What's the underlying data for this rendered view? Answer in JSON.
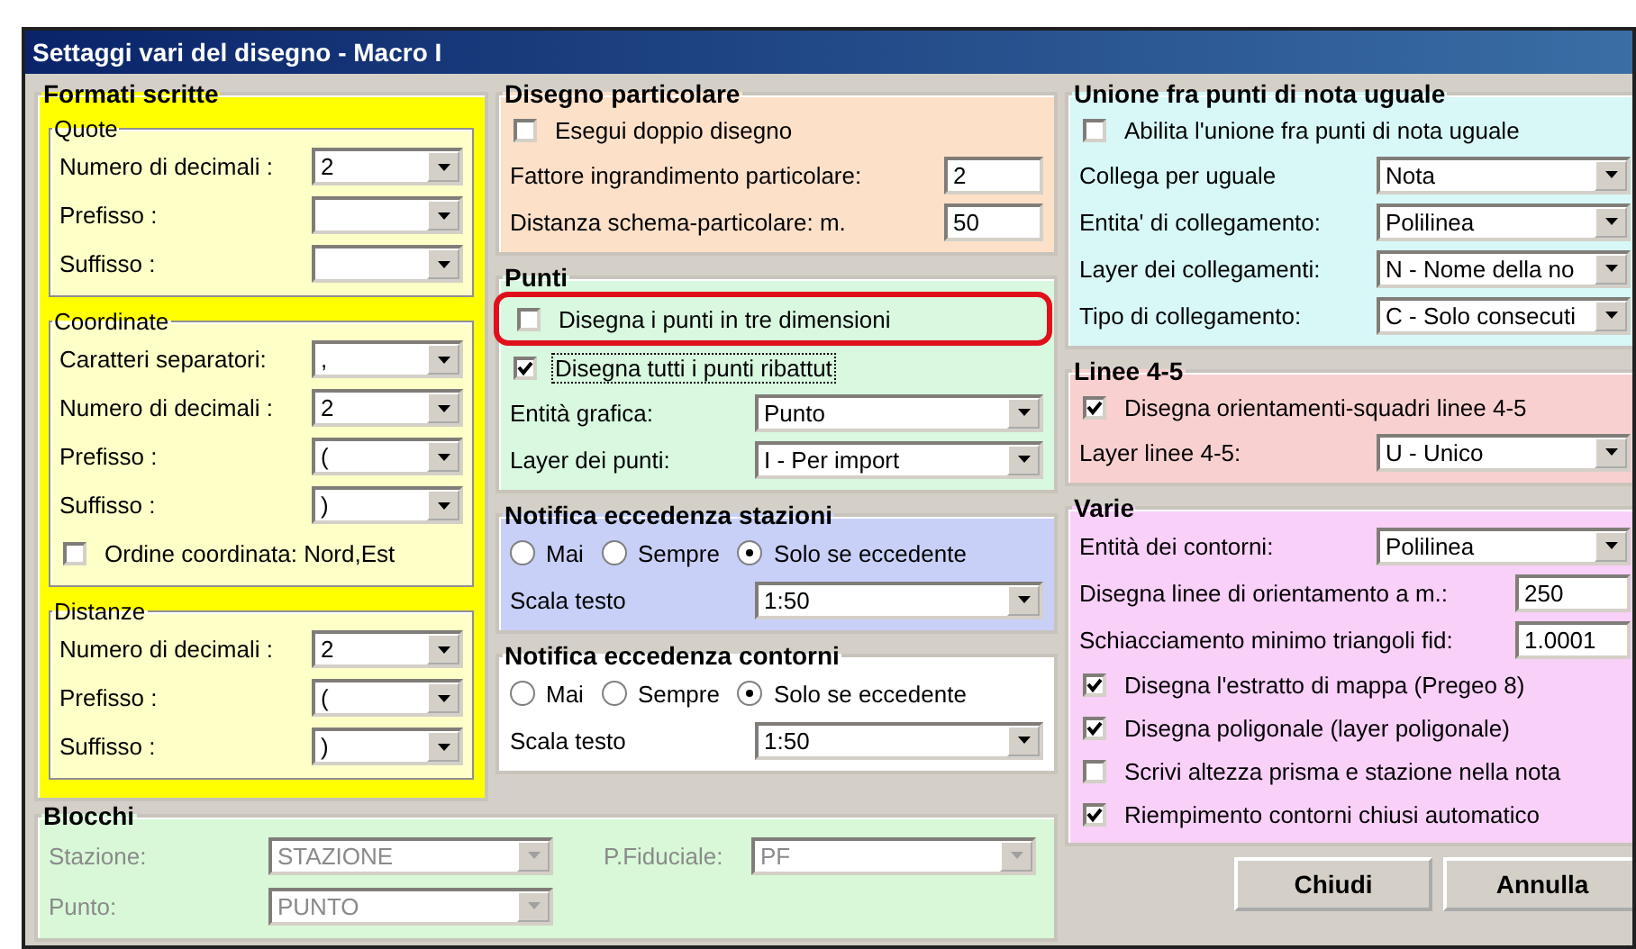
{
  "window": {
    "title": "Settaggi vari del disegno - Macro I"
  },
  "columns": [
    {
      "groups": [
        {
          "title": "Formati scritte",
          "color": "#ffff00",
          "items": [
            {
              "kind": "group",
              "title": "Quote",
              "color": "#ffffc8",
              "items": [
                {
                  "kind": "combo",
                  "label": "Numero di decimali :",
                  "value": "2"
                },
                {
                  "kind": "combo",
                  "label": "Prefisso :"
                },
                {
                  "kind": "combo",
                  "label": "Suffisso :"
                }
              ]
            },
            {
              "kind": "group",
              "title": "Coordinate",
              "color": "#ffffc8",
              "items": [
                {
                  "kind": "combo",
                  "label": "Caratteri separatori:",
                  "value": ","
                },
                {
                  "kind": "combo",
                  "label": "Numero di decimali :",
                  "value": "2"
                },
                {
                  "kind": "combo",
                  "label": "Prefisso :",
                  "value": "("
                },
                {
                  "kind": "combo",
                  "label": "Suffisso :",
                  "value": ")"
                },
                {
                  "kind": "check",
                  "label": "Ordine coordinata: Nord,Est",
                  "checked": false
                }
              ]
            },
            {
              "kind": "group",
              "title": "Distanze",
              "color": "#ffffc8",
              "items": [
                {
                  "kind": "combo",
                  "label": "Numero di decimali :",
                  "value": "2"
                },
                {
                  "kind": "combo",
                  "label": "Prefisso :",
                  "value": "("
                },
                {
                  "kind": "combo",
                  "label": "Suffisso :",
                  "value": ")"
                }
              ]
            }
          ]
        }
      ]
    },
    {
      "groups": [
        {
          "title": "Disegno particolare",
          "color": "#fce0c8",
          "items": [
            {
              "kind": "check",
              "label": "Esegui doppio disegno",
              "checked": false
            },
            {
              "kind": "input",
              "label": "Fattore ingrandimento particolare:",
              "value": "2"
            },
            {
              "kind": "input",
              "label": "Distanza schema-particolare: m.",
              "value": "50"
            }
          ]
        },
        {
          "title": "Punti",
          "color": "#d8f8e0",
          "items": [
            {
              "kind": "check",
              "label": "Disegna i punti in tre dimensioni",
              "checked": false,
              "highlighted": true
            },
            {
              "kind": "check",
              "label": "Disegna tutti i punti ribattut",
              "checked": true,
              "focused": true
            },
            {
              "kind": "combo",
              "label": "Entità grafica:",
              "value": "Punto"
            },
            {
              "kind": "combo",
              "label": "Layer dei punti:",
              "value": "I - Per import"
            }
          ]
        },
        {
          "title": "Notifica eccedenza stazioni",
          "color": "#c8d0f8",
          "items": [
            {
              "kind": "radios",
              "options": [
                {
                  "label": "Mai",
                  "selected": false
                },
                {
                  "label": "Sempre",
                  "selected": false
                },
                {
                  "label": "Solo se eccedente",
                  "selected": true
                }
              ]
            },
            {
              "kind": "combo",
              "label": "Scala testo",
              "value": "1:50"
            }
          ]
        },
        {
          "title": "Notifica eccedenza contorni",
          "color": "#ffffff",
          "items": [
            {
              "kind": "radios",
              "options": [
                {
                  "label": "Mai",
                  "selected": false
                },
                {
                  "label": "Sempre",
                  "selected": false
                },
                {
                  "label": "Solo se eccedente",
                  "selected": true
                }
              ]
            },
            {
              "kind": "combo",
              "label": "Scala testo",
              "value": "1:50"
            }
          ]
        }
      ]
    },
    {
      "groups": [
        {
          "title": "Unione fra punti di nota uguale",
          "color": "#d8f8f8",
          "items": [
            {
              "kind": "check",
              "label": "Abilita l'unione fra punti di nota uguale",
              "checked": false
            },
            {
              "kind": "combo",
              "label": "Collega per uguale",
              "value": "Nota"
            },
            {
              "kind": "combo",
              "label": "Entita' di collegamento:",
              "value": "Polilinea"
            },
            {
              "kind": "combo",
              "label": "Layer dei collegamenti:",
              "value": "N - Nome della no"
            },
            {
              "kind": "combo",
              "label": "Tipo di collegamento:",
              "value": "C - Solo consecuti"
            }
          ]
        },
        {
          "title": "Linee 4-5",
          "color": "#f8d0d0",
          "items": [
            {
              "kind": "check",
              "label": "Disegna orientamenti-squadri linee 4-5",
              "checked": true
            },
            {
              "kind": "combo",
              "label": "Layer linee 4-5:",
              "value": "U - Unico"
            }
          ]
        },
        {
          "title": "Varie",
          "color": "#f8d0f8",
          "items": [
            {
              "kind": "combo",
              "label": "Entità dei contorni:",
              "value": "Polilinea"
            },
            {
              "kind": "input",
              "label": "Disegna linee di orientamento a m.:",
              "value": "250"
            },
            {
              "kind": "input",
              "label": "Schiacciamento minimo triangoli fid:",
              "value": "1.0001"
            },
            {
              "kind": "check",
              "label": "Disegna l'estratto di mappa (Pregeo 8)",
              "checked": true
            },
            {
              "kind": "check",
              "label": "Disegna poligonale (layer poligonale)",
              "checked": true
            },
            {
              "kind": "check",
              "label": "Scrivi altezza prisma e stazione nella nota",
              "checked": false
            },
            {
              "kind": "check",
              "label": "Riempimento contorni chiusi automatico",
              "checked": true
            }
          ]
        }
      ]
    }
  ],
  "blocchi": {
    "title": "Blocchi",
    "color": "#d8f8d8",
    "items": [
      {
        "kind": "combo",
        "label": "Stazione:",
        "value": "STAZIONE",
        "disabled": true
      },
      {
        "kind": "combo",
        "label": "Punto:",
        "value": "PUNTO",
        "disabled": true
      },
      {
        "kind": "combo",
        "label": "P.Fiduciale:",
        "value": "PF",
        "disabled": true
      }
    ]
  },
  "buttons": [
    {
      "label": "Chiudi"
    },
    {
      "label": "Annulla"
    }
  ]
}
